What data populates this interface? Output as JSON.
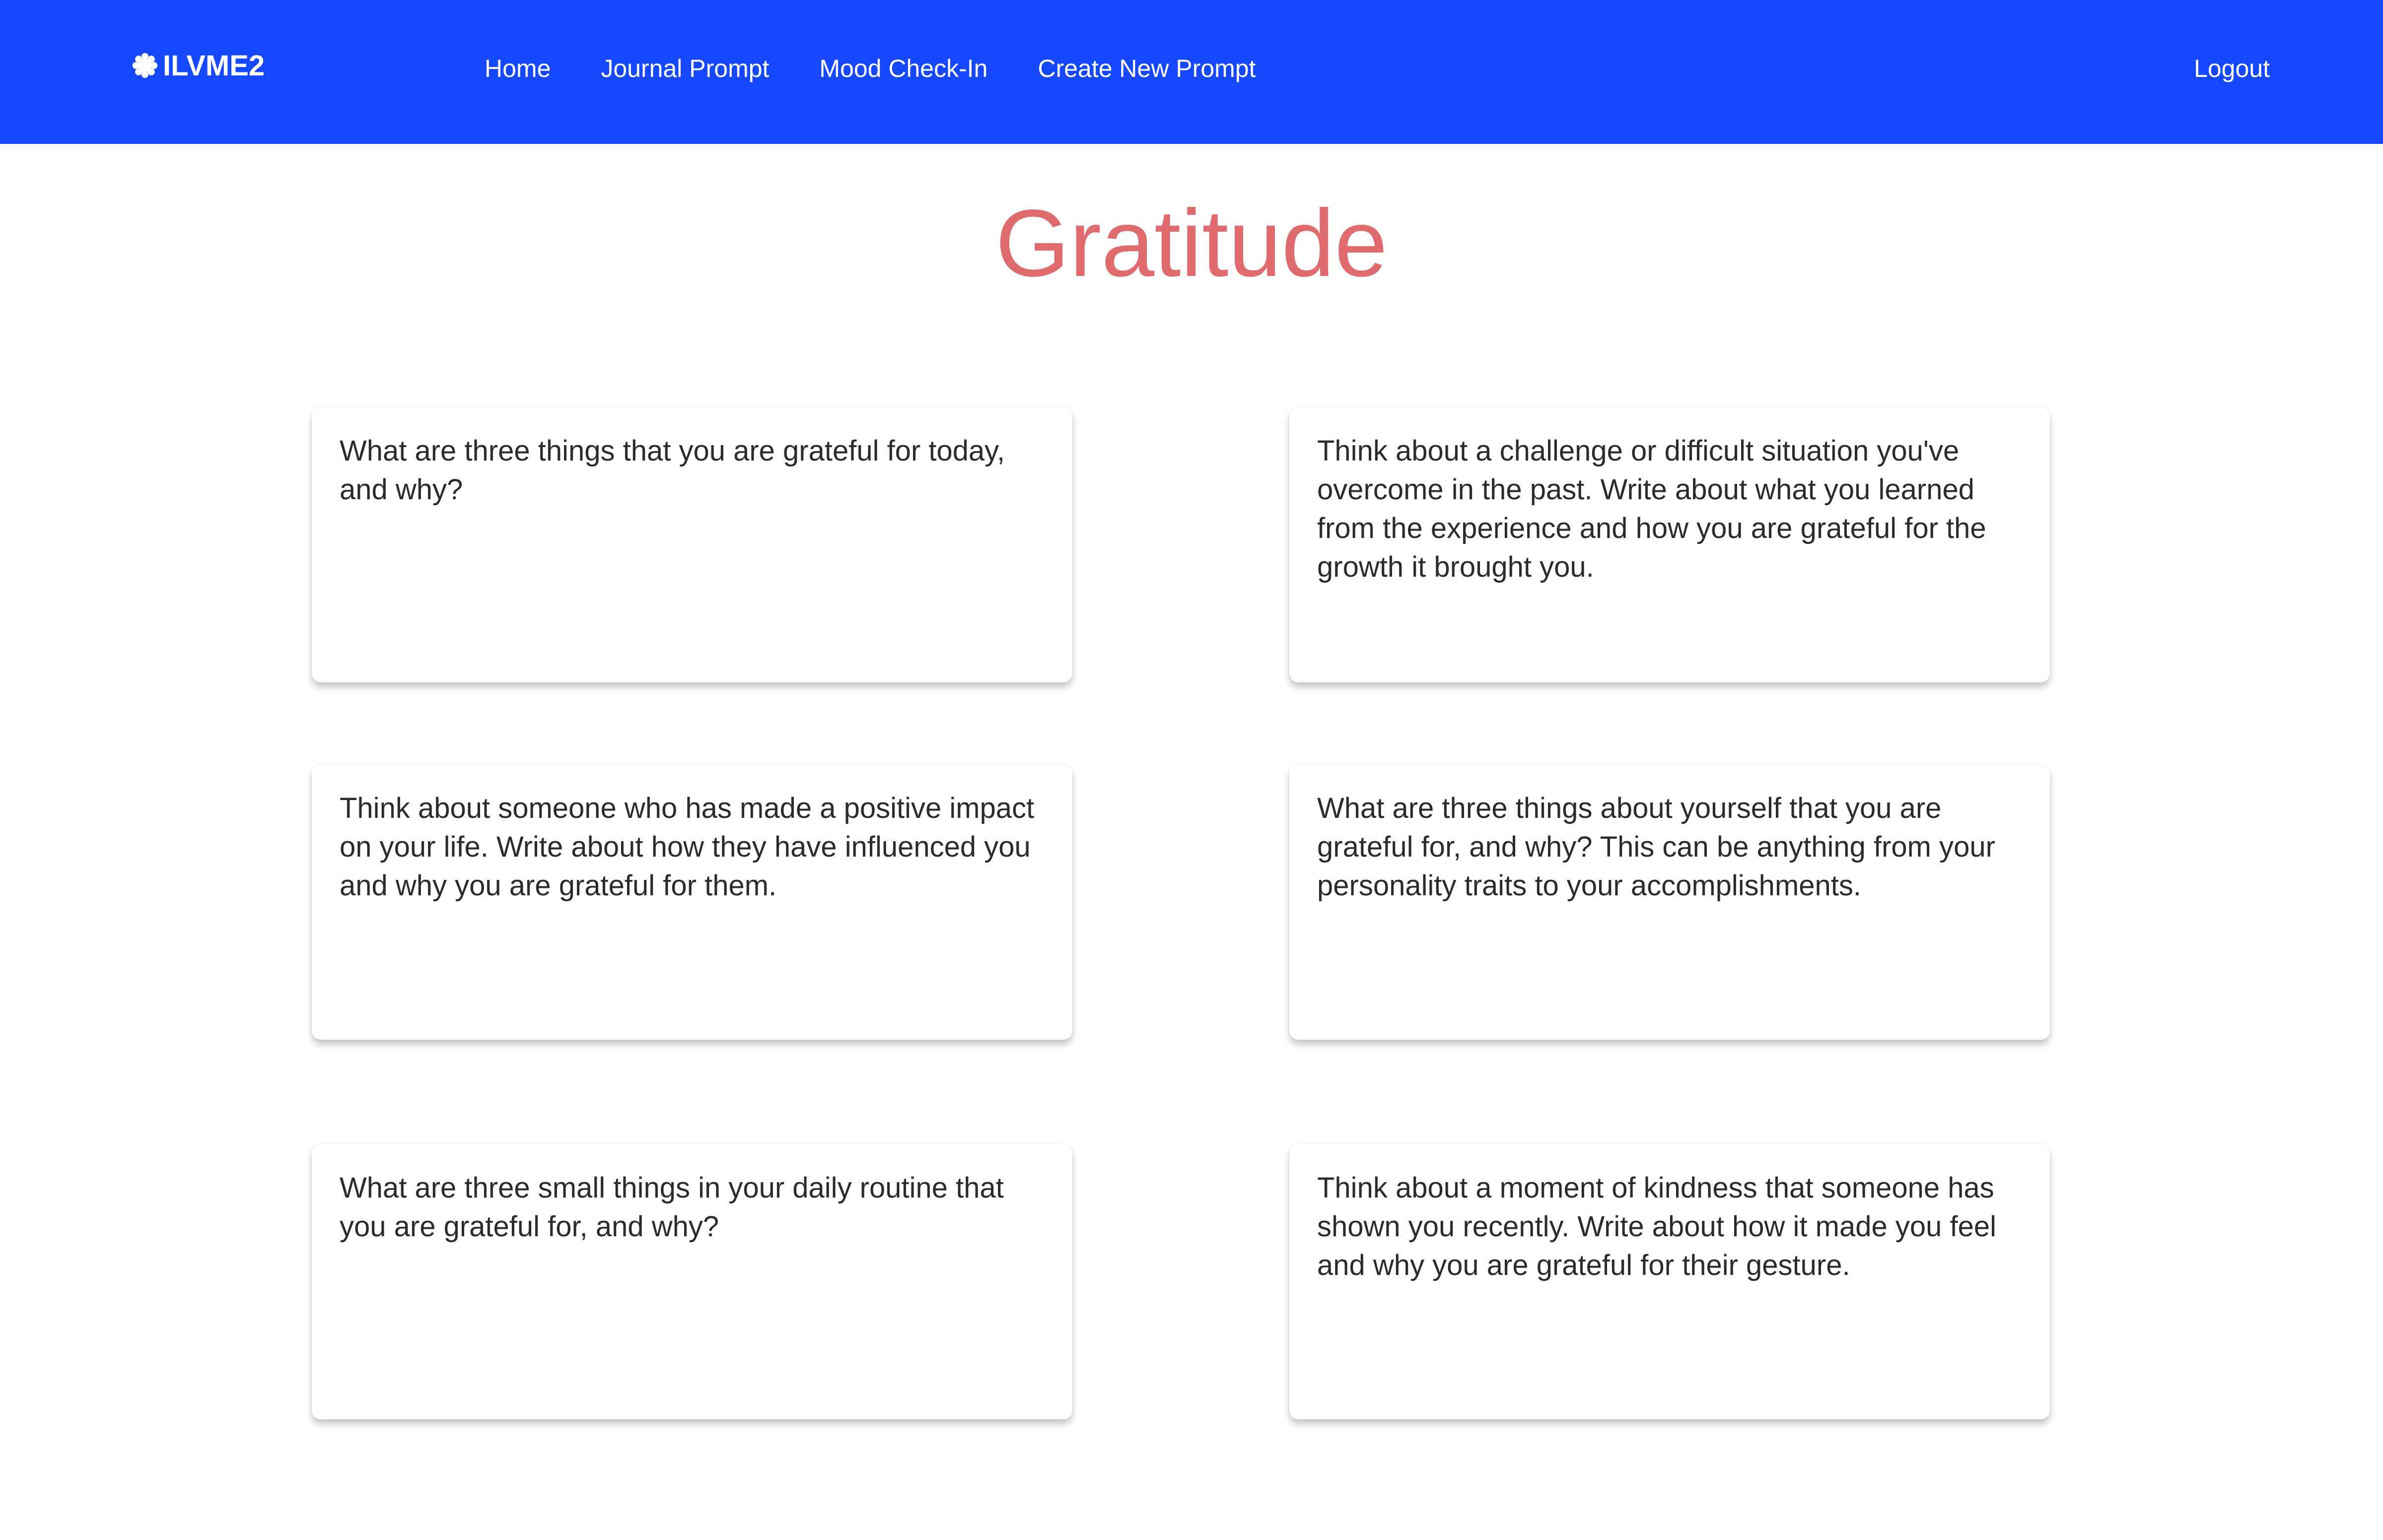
{
  "header": {
    "brand": "ILVME2",
    "brand_icon": "flower-icon",
    "nav": [
      "Home",
      "Journal Prompt",
      "Mood Check-In",
      "Create New Prompt"
    ],
    "logout": "Logout",
    "colors": {
      "background": "#1548ff",
      "text": "#ffffff"
    }
  },
  "main": {
    "title": "Gratitude",
    "title_color": "#e06b6e",
    "prompts": [
      "What are three things that you are grateful for today, and why?",
      "Think about a challenge or difficult situation you've overcome in the past. Write about what you learned from the experience and how you are grateful for the growth it brought you.",
      "Think about someone who has made a positive impact on your life. Write about how they have influenced you and why you are grateful for them.",
      "What are three things about yourself that you are grateful for, and why? This can be anything from your personality traits to your accomplishments.",
      "What are three small things in your daily routine that you are grateful for, and why?",
      "Think about a moment of kindness that someone has shown you recently. Write about how it made you feel and why you are grateful for their gesture."
    ]
  }
}
